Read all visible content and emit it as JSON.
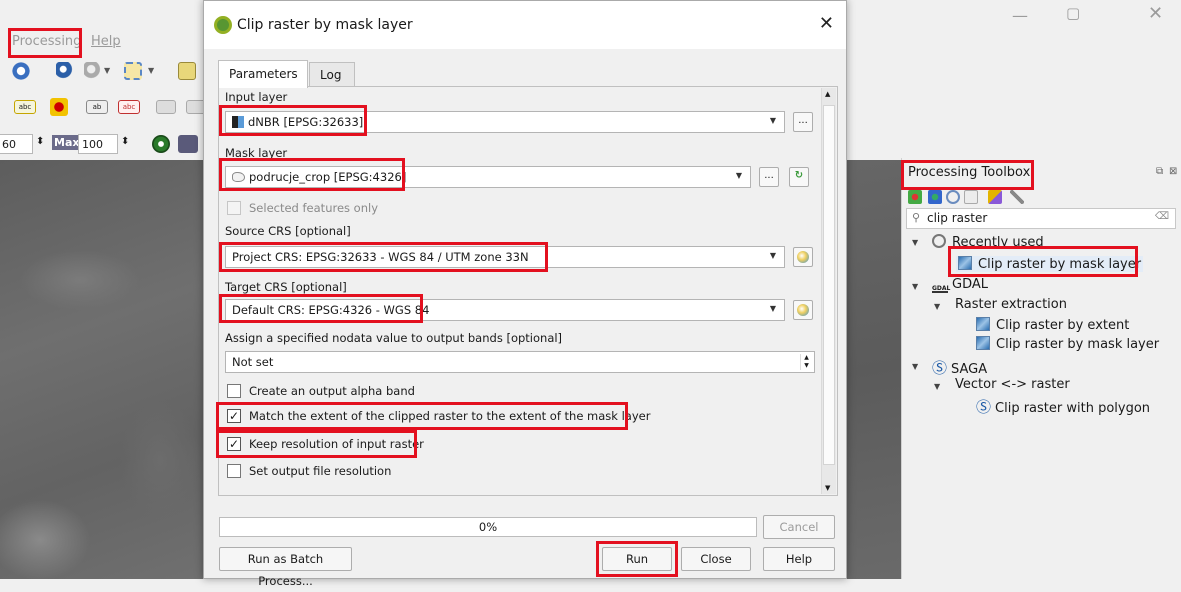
{
  "main_window": {
    "menu": {
      "processing": "Processing",
      "help": "Help"
    },
    "spin_min_value": "60",
    "spin_max_label": "Max",
    "spin_max_value": "100"
  },
  "dialog": {
    "title": "Clip raster by mask layer",
    "close_symbol": "✕",
    "tabs": [
      {
        "label": "Parameters"
      },
      {
        "label": "Log"
      }
    ],
    "params": {
      "input_layer": {
        "label": "Input layer",
        "value": "dNBR [EPSG:32633]"
      },
      "mask_layer": {
        "label": "Mask layer",
        "value": "podrucje_crop [EPSG:4326]"
      },
      "selected_only": {
        "label": "Selected features only"
      },
      "source_crs": {
        "label": "Source CRS [optional]",
        "value": "Project CRS: EPSG:32633 - WGS 84 / UTM zone 33N"
      },
      "target_crs": {
        "label": "Target CRS [optional]",
        "value": "Default CRS: EPSG:4326 - WGS 84"
      },
      "nodata": {
        "label": "Assign a specified nodata value to output bands [optional]",
        "value": "Not set"
      },
      "alpha_band": {
        "label": "Create an output alpha band",
        "checked": false
      },
      "match_extent": {
        "label": "Match the extent of the clipped raster to the extent of the mask layer",
        "checked": true
      },
      "keep_resolution": {
        "label": "Keep resolution of input raster",
        "checked": true
      },
      "set_resolution": {
        "label": "Set output file resolution",
        "checked": false
      }
    },
    "browse_label": "...",
    "check_mark": "✓",
    "progress": {
      "value": 0,
      "text": "0%"
    },
    "buttons": {
      "cancel": "Cancel",
      "batch": "Run as Batch Process...",
      "run": "Run",
      "close": "Close",
      "help": "Help"
    }
  },
  "toolbox": {
    "title": "Processing Toolbox",
    "search_value": "clip raster",
    "tree": {
      "recently_used": "Recently used",
      "recent_item": "Clip raster by mask layer",
      "gdal": "GDAL",
      "raster_extraction": "Raster extraction",
      "gdal_items": [
        "Clip raster by extent",
        "Clip raster by mask layer"
      ],
      "saga": "SAGA",
      "vector_raster": "Vector <-> raster",
      "saga_item": "Clip raster with polygon"
    }
  },
  "colors": {
    "highlight": "#e3101f",
    "qgis_green": "#589632"
  }
}
